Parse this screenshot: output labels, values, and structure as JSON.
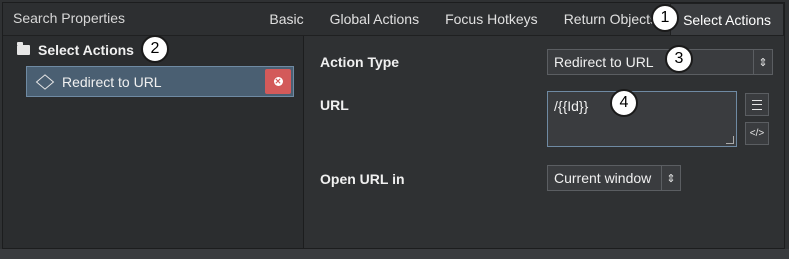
{
  "header": {
    "title": "Search Properties",
    "tabs": [
      "Basic",
      "Global Actions",
      "Focus Hotkeys",
      "Return Objects",
      "Select Actions"
    ],
    "active_tab_index": 4
  },
  "left_panel": {
    "group_label": "Select Actions",
    "items": [
      {
        "label": "Redirect to URL",
        "delete_icon": "x-circle-icon"
      }
    ]
  },
  "form": {
    "action_type_label": "Action Type",
    "action_type_value": "Redirect to URL",
    "url_label": "URL",
    "url_value": "/{{Id}}",
    "open_url_label": "Open URL in",
    "open_url_value": "Current window"
  },
  "markers": [
    "1",
    "2",
    "3",
    "4"
  ],
  "colors": {
    "selected_item_bg": "#4a5f72",
    "delete_button": "#d35a5a",
    "panel_bg": "#2b2d2f"
  }
}
